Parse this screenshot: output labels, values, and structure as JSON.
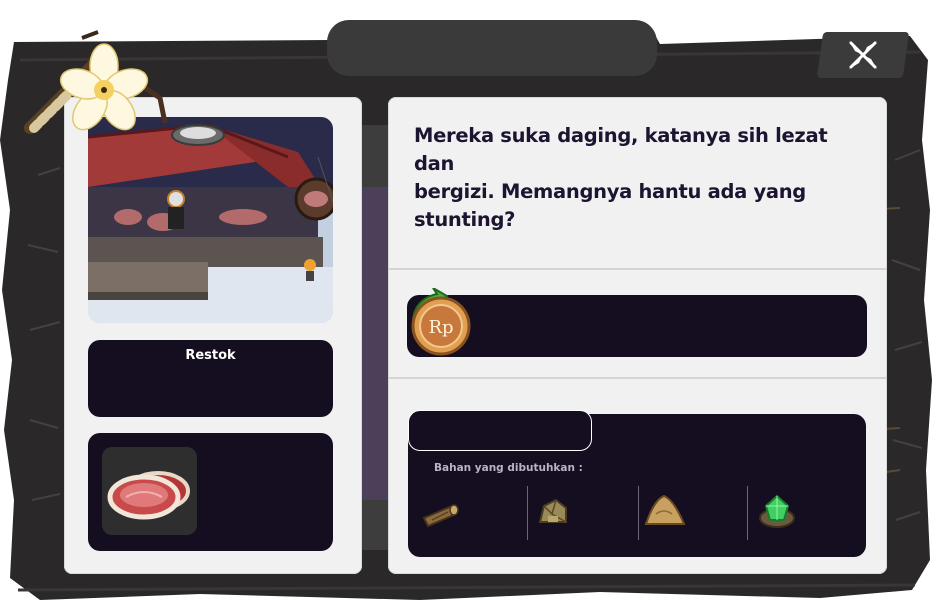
{
  "dialog": {
    "text_line1": "Mereka suka daging, katanya sih lezat dan",
    "text_line2": "bergizi. Memangnya hantu ada yang",
    "text_line3": "stunting?"
  },
  "restock": {
    "title": "Restok"
  },
  "requirements": {
    "label": "Bahan yang dibutuhkan :"
  },
  "currency": {
    "symbol": "Rp"
  },
  "materials": [
    {
      "name": "wood-log-icon"
    },
    {
      "name": "stone-ore-icon"
    },
    {
      "name": "sand-pile-icon"
    },
    {
      "name": "green-gem-icon"
    }
  ],
  "colors": {
    "frame": "#2d2a2b",
    "dark_card": "#150d20",
    "panel": "#f1f1f1",
    "spine": "#4b3f5a",
    "text": "#1c1430"
  }
}
